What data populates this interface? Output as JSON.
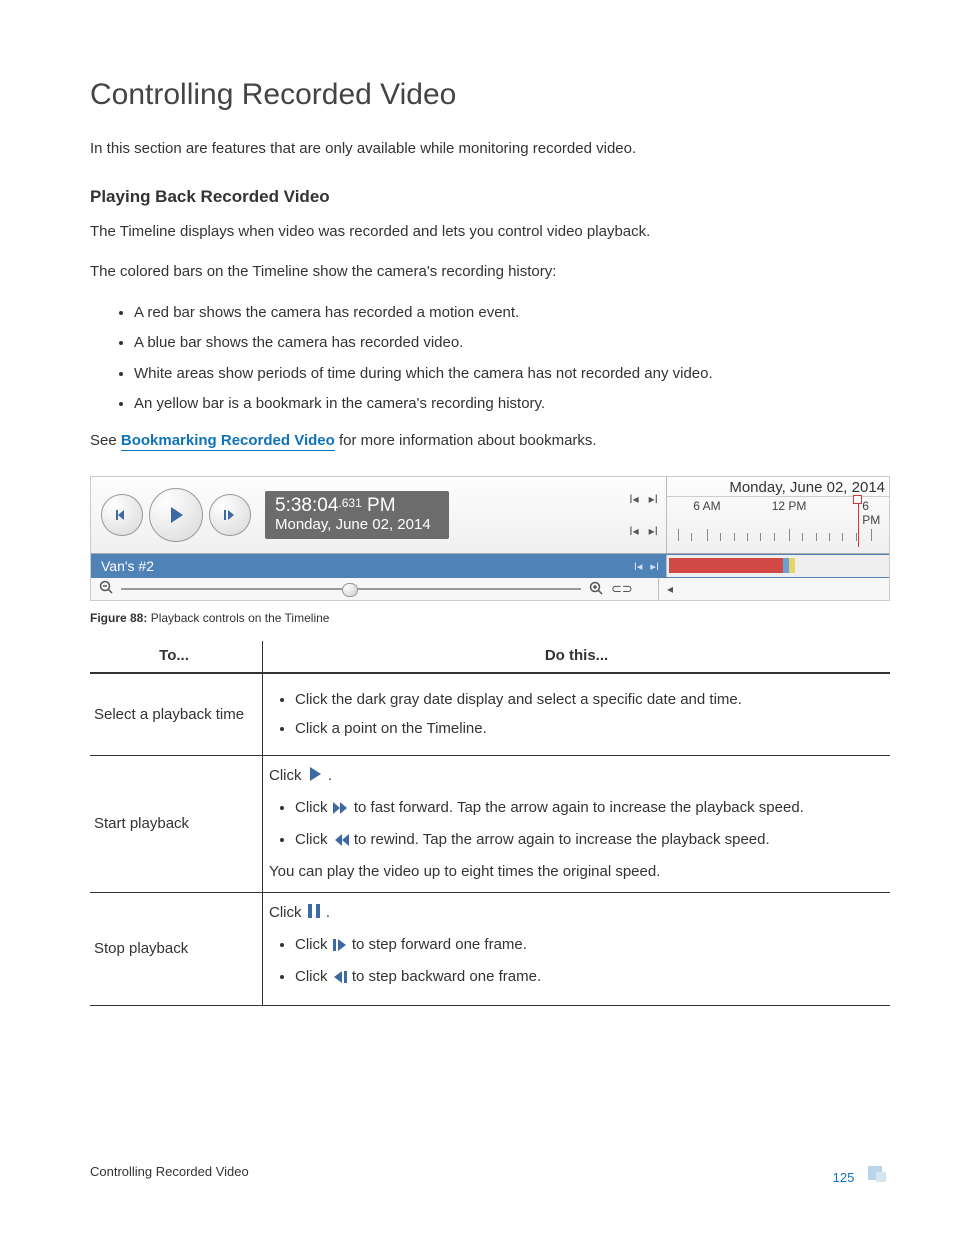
{
  "title": "Controlling Recorded Video",
  "intro": "In this section are features that are only available while monitoring recorded video.",
  "subhead": "Playing Back Recorded Video",
  "p1": "The Timeline displays when video was recorded and lets you control video playback.",
  "p2": "The colored bars on the Timeline show the camera's recording history:",
  "bars": [
    "A red bar shows the camera has recorded a motion event.",
    "A blue bar shows the camera has recorded video.",
    "White areas show periods of time during which the camera has not recorded any video.",
    "An yellow bar is a bookmark in the camera's recording history."
  ],
  "see_prefix": "See ",
  "see_link": "Bookmarking Recorded Video",
  "see_suffix": " for more information about bookmarks.",
  "timeline": {
    "time_main": "5:38:04",
    "time_ms": ".631",
    "time_ampm": " PM",
    "date": "Monday, June 02, 2014",
    "header_date": "Monday, June 02, 2014",
    "ticks": [
      "6 AM",
      "12 PM",
      "6 PM"
    ],
    "camera": "Van's #2"
  },
  "caption_label": "Figure 88:",
  "caption_text": " Playback controls on the Timeline",
  "table": {
    "h1": "To...",
    "h2": "Do this...",
    "r1_left": "Select a playback time",
    "r1_b1": "Click the dark gray date display and select a specific date and time.",
    "r1_b2": "Click a point on the Timeline.",
    "r2_left": "Start playback",
    "r2_click": "Click ",
    "r2_b1a": "Click ",
    "r2_b1b": " to fast forward. Tap the arrow again to increase the playback speed.",
    "r2_b2a": "Click ",
    "r2_b2b": " to rewind. Tap the arrow again to increase the playback speed.",
    "r2_note": "You can play the video up to eight times the original speed.",
    "r3_left": "Stop playback",
    "r3_click": "Click ",
    "r3_b1a": "Click ",
    "r3_b1b": " to step forward one frame.",
    "r3_b2a": "Click ",
    "r3_b2b": " to step backward one frame."
  },
  "footer_left": "Controlling Recorded Video",
  "footer_page": "125"
}
